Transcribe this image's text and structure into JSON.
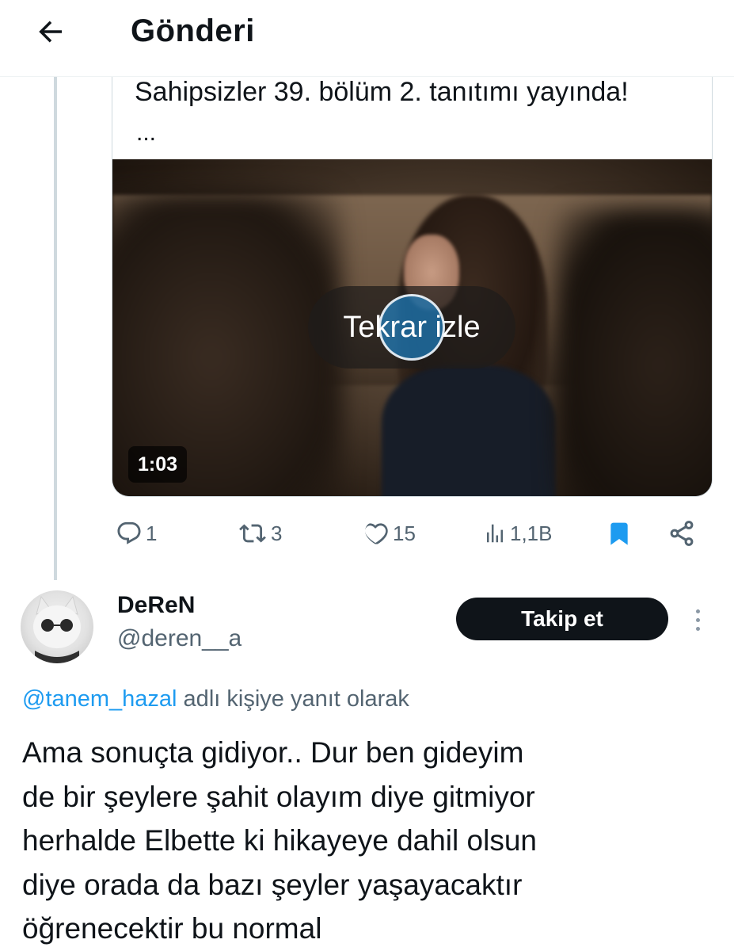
{
  "header": {
    "title": "Gönderi",
    "back_icon": "arrow-left-icon"
  },
  "quoted_post": {
    "text": "Sahipsizler 39. bölüm 2. tanıtımı yayında!",
    "ellipsis": "...",
    "video": {
      "replay_label": "Tekrar izle",
      "duration": "1:03"
    }
  },
  "actions": {
    "replies": "1",
    "reposts": "3",
    "likes": "15",
    "views": "1,1B",
    "bookmark_color": "#1d9bf0"
  },
  "reply": {
    "author_name": "DeReN",
    "author_handle": "@deren__a",
    "follow_label": "Takip et",
    "replying_to_mention": "@tanem_hazal",
    "replying_to_suffix": " adlı kişiye yanıt olarak",
    "text": "Ama sonuçta  gidiyor.. Dur ben gideyim\nde bir şeylere şahit olayım diye gitmiyor\nherhalde Elbette ki hikayeye dahil olsun\ndiye orada da bazı şeyler yaşayacaktır\nöğrenecektir bu normal"
  },
  "colors": {
    "accent": "#1d9bf0",
    "text_primary": "#0f1419",
    "text_secondary": "#536471"
  }
}
